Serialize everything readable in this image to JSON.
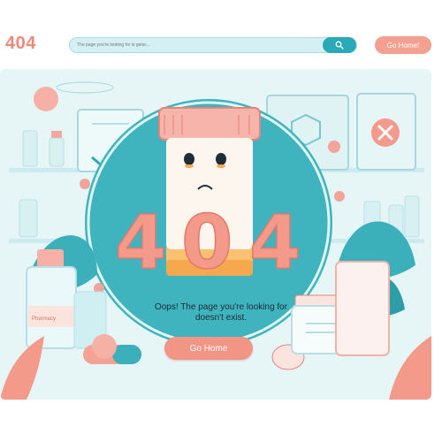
{
  "header": {
    "logo": "404",
    "search_placeholder": "The page you're looking for is gone...",
    "go_home_label": "Go Home!"
  },
  "main": {
    "error_code": "404",
    "message_line1": "Oops! The page you're looking for",
    "message_line2": "doesn't exist.",
    "go_home_label": "Go Home",
    "bottle_label": "Pharmacy"
  },
  "icons": [
    "search-icon",
    "close-icon",
    "checkmark-icon",
    "pill-bottle-icon"
  ],
  "colors": {
    "accent_coral": "#f39a8a",
    "accent_teal": "#2aaab8",
    "background_mint": "#eaf8f8"
  }
}
